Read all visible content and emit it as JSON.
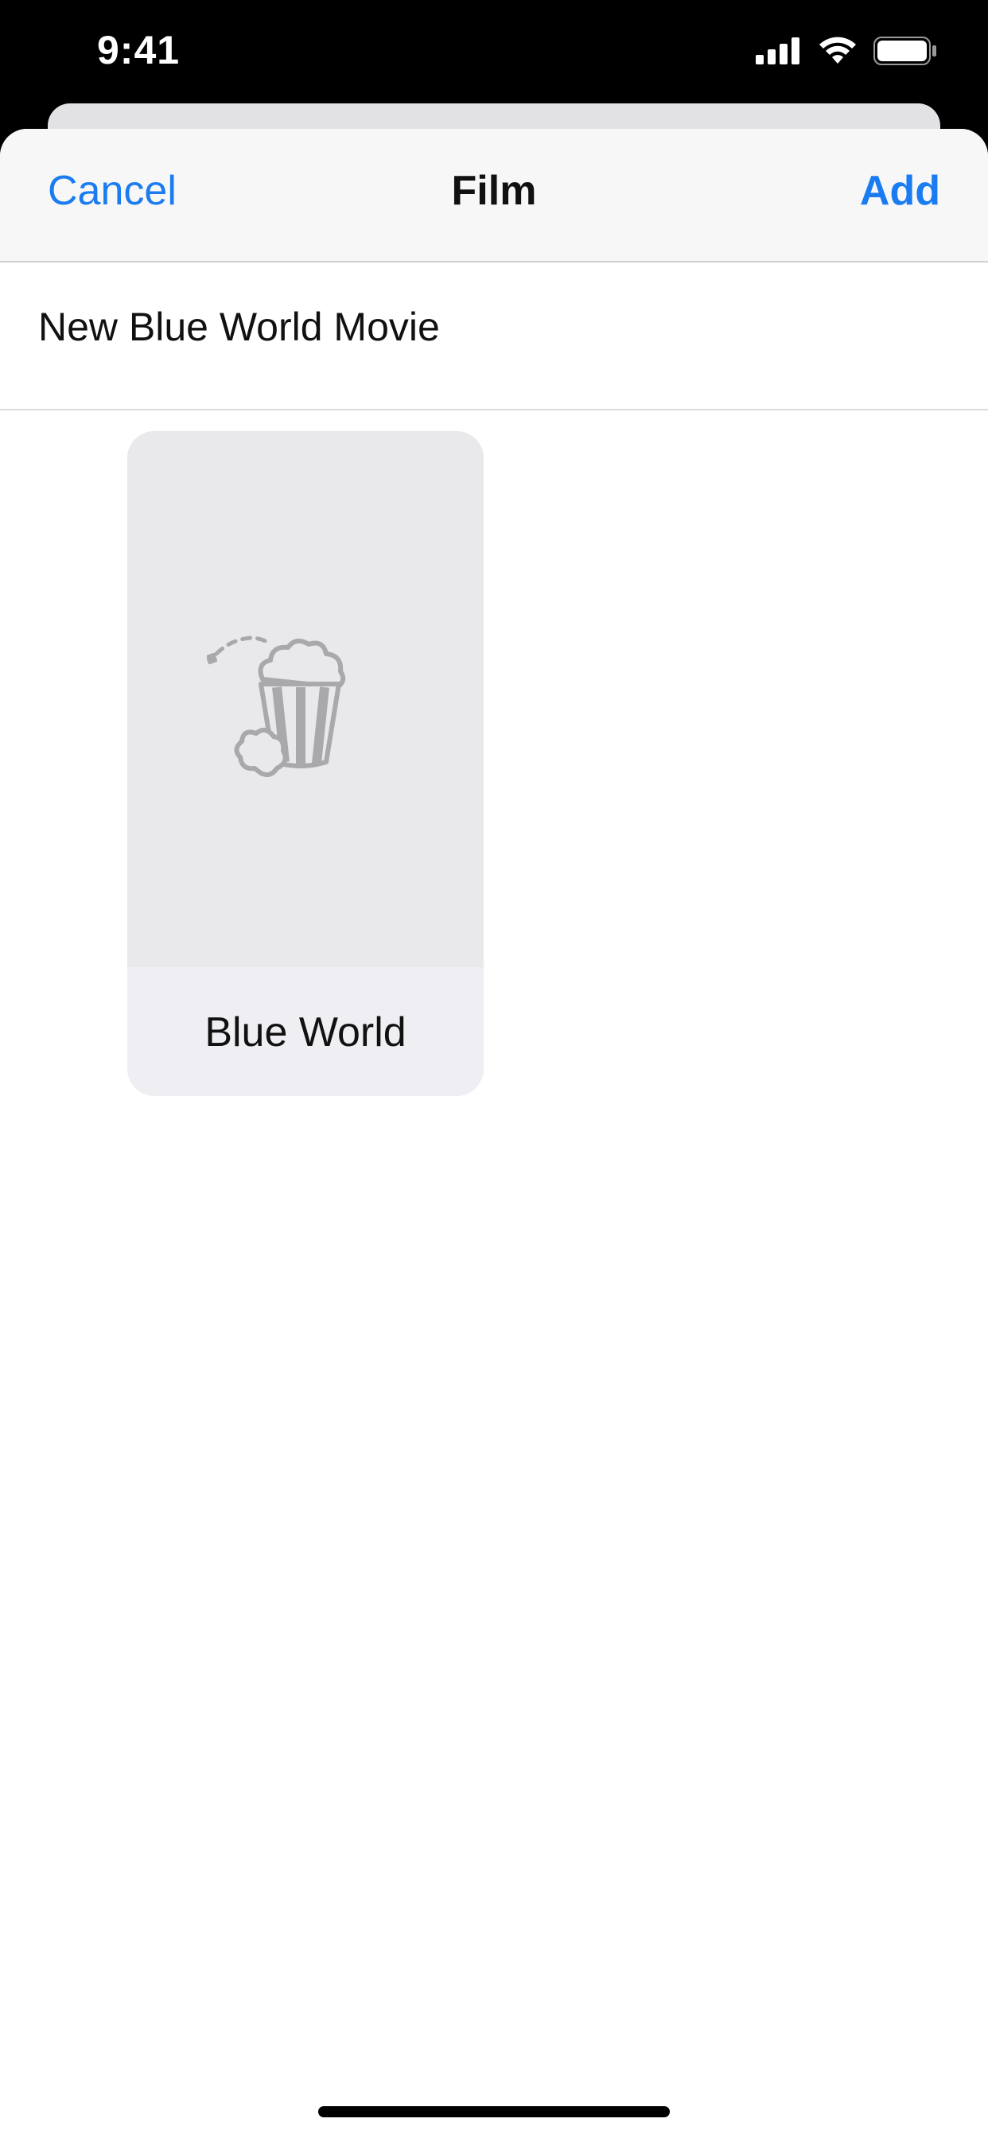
{
  "status_bar": {
    "time": "9:41",
    "icons": [
      "cellular-signal-icon",
      "wifi-icon",
      "battery-icon"
    ]
  },
  "nav": {
    "cancel_label": "Cancel",
    "title": "Film",
    "add_label": "Add"
  },
  "name_field": {
    "value": "New Blue World Movie",
    "placeholder": ""
  },
  "items": [
    {
      "label": "Blue World",
      "icon": "popcorn-icon"
    }
  ],
  "colors": {
    "accent": "#1a7cf0",
    "nav_background": "#f7f7f7",
    "card_art_background": "#e9e9eb",
    "card_footer_background": "#efeff3",
    "icon_gray": "#a9a9ad"
  }
}
